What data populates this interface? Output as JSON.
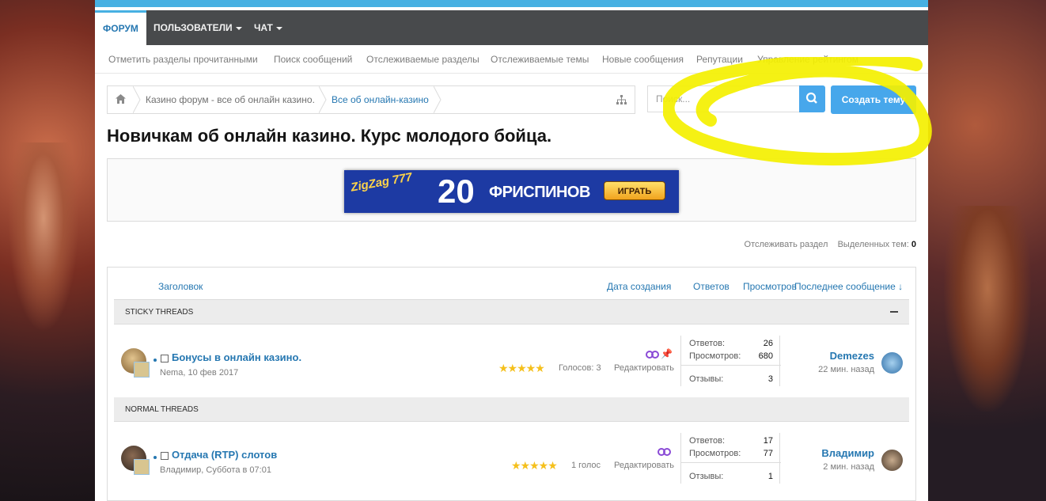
{
  "nav": {
    "tabs": [
      {
        "label": "Форум",
        "active": true
      },
      {
        "label": "Пользователи",
        "dropdown": true
      },
      {
        "label": "Чат",
        "dropdown": true
      }
    ]
  },
  "subnav": {
    "links": [
      "Отметить разделы прочитанными",
      "Поиск сообщений",
      "Отслеживаемые разделы",
      "Отслеживаемые темы",
      "Новые сообщения",
      "Репутации",
      "Управление рейтингом"
    ]
  },
  "breadcrumb": {
    "home_icon": "home-icon",
    "items": [
      "Казино форум - все об онлайн казино.",
      "Все об онлайн-казино"
    ],
    "sitemap_icon": "sitemap-icon"
  },
  "search": {
    "placeholder": "Поиск...",
    "icon": "search-icon"
  },
  "create_button": "Создать тему",
  "page_title": "Новичкам об онлайн казино. Курс молодого бойца.",
  "banner": {
    "logo": "ZigZag 777",
    "number": "20",
    "text": "ФРИСПИНОВ",
    "button": "ИГРАТЬ"
  },
  "forum_meta": {
    "watch": "Отслеживать раздел",
    "selected_label": "Выделенных тем:",
    "selected_count": "0"
  },
  "columns": {
    "title": "Заголовок",
    "created": "Дата создания",
    "replies": "Ответов",
    "views": "Просмотров",
    "last": "Последнее сообщение ↓"
  },
  "sections": [
    {
      "label": "STICKY THREADS",
      "threads": [
        {
          "title": "Бонусы в онлайн казино.",
          "author_date": "Nema, 10 фев 2017",
          "rating_stars": 5,
          "stars": "★★★★★",
          "votes": "Голосов: 3",
          "edit": "Редактировать",
          "stats": {
            "replies_label": "Ответов:",
            "replies": "26",
            "views_label": "Просмотров:",
            "views": "680",
            "reviews_label": "Отзывы:",
            "reviews": "3"
          },
          "last_user": "Demezes",
          "last_time": "22 мин. назад",
          "pinned": true
        }
      ]
    },
    {
      "label": "NORMAL THREADS",
      "threads": [
        {
          "title": "Отдача (RTP) слотов",
          "author_date": "Владимир, Суббота в 07:01",
          "rating_stars": 5,
          "stars": "★★★★★",
          "votes": "1 голос",
          "edit": "Редактировать",
          "stats": {
            "replies_label": "Ответов:",
            "replies": "17",
            "views_label": "Просмотров:",
            "views": "77",
            "reviews_label": "Отзывы:",
            "reviews": "1"
          },
          "last_user": "Владимир",
          "last_time": "2 мин. назад",
          "pinned": false
        }
      ]
    }
  ],
  "colors": {
    "accent": "#2577b1",
    "button": "#47a7eb",
    "nav_bg": "#484a4c",
    "highlight": "#f4f000"
  }
}
